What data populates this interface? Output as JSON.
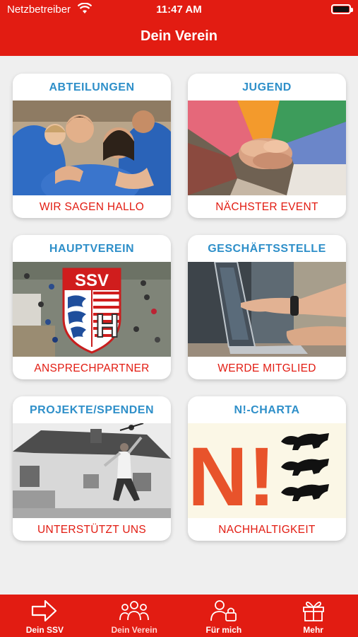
{
  "status": {
    "carrier": "Netzbetreiber",
    "time": "11:47 AM"
  },
  "header": {
    "title": "Dein Verein"
  },
  "cards": [
    {
      "title": "ABTEILUNGEN",
      "subtitle": "WIR SAGEN HALLO",
      "image": "group-huddle-photo"
    },
    {
      "title": "JUGEND",
      "subtitle": "NÄCHSTER EVENT",
      "image": "stacked-hands-photo"
    },
    {
      "title": "HAUPTVEREIN",
      "subtitle": "ANSPRECHPARTNER",
      "image": "ssv-crest-aerial-photo",
      "crest_text": "SSV",
      "crest_letter": "H"
    },
    {
      "title": "GESCHÄFTSSTELLE",
      "subtitle": "WERDE MITGLIED",
      "image": "laptop-typing-photo"
    },
    {
      "title": "PROJEKTE/SPENDEN",
      "subtitle": "UNTERSTÜTZT UNS",
      "image": "house-jump-photo"
    },
    {
      "title": "N!-CHARTA",
      "subtitle": "NACHHALTIGKEIT",
      "image": "n-charta-logo",
      "logo_text": "N!"
    }
  ],
  "tabs": [
    {
      "label": "Dein SSV",
      "icon": "arrow-right-icon"
    },
    {
      "label": "Dein Verein",
      "icon": "people-icon"
    },
    {
      "label": "Für mich",
      "icon": "user-lock-icon"
    },
    {
      "label": "Mehr",
      "icon": "gift-box-icon"
    }
  ],
  "colors": {
    "brand_red": "#e21c12",
    "title_blue": "#2e8fc9",
    "background": "#efefef"
  },
  "active_tab": "Dein Verein"
}
